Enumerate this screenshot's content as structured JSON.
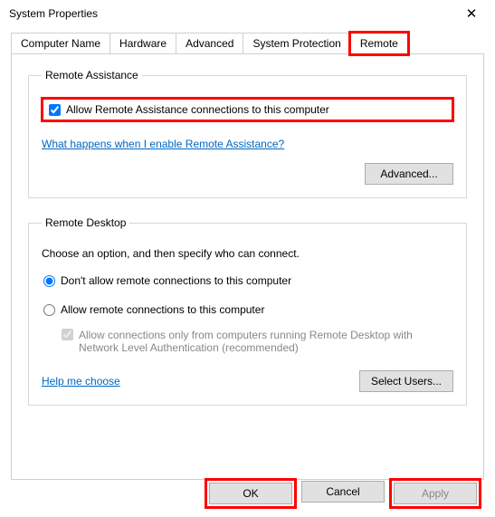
{
  "window": {
    "title": "System Properties"
  },
  "tabs": {
    "computer_name": "Computer Name",
    "hardware": "Hardware",
    "advanced": "Advanced",
    "system_protection": "System Protection",
    "remote": "Remote"
  },
  "remote_assistance": {
    "legend": "Remote Assistance",
    "allow_label": "Allow Remote Assistance connections to this computer",
    "allow_checked": true,
    "help_link": "What happens when I enable Remote Assistance?",
    "advanced_button": "Advanced..."
  },
  "remote_desktop": {
    "legend": "Remote Desktop",
    "description": "Choose an option, and then specify who can connect.",
    "option_dont_allow": "Don't allow remote connections to this computer",
    "option_allow": "Allow remote connections to this computer",
    "selected": "dont_allow",
    "nla_label": "Allow connections only from computers running Remote Desktop with Network Level Authentication (recommended)",
    "nla_checked": true,
    "nla_enabled": false,
    "help_link": "Help me choose",
    "select_users_button": "Select Users..."
  },
  "footer": {
    "ok": "OK",
    "cancel": "Cancel",
    "apply": "Apply",
    "apply_enabled": false
  }
}
